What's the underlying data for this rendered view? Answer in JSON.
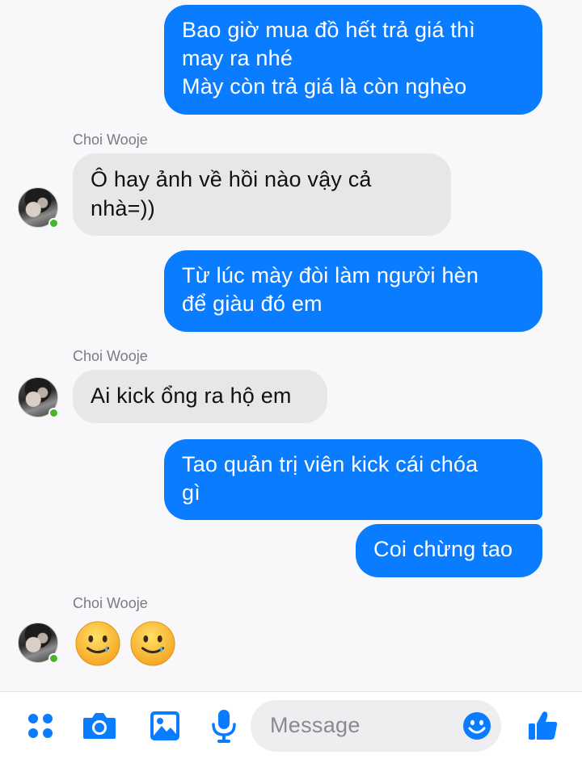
{
  "conversation": {
    "messages": [
      {
        "direction": "outgoing",
        "text": "Bao giờ mua đồ hết trả giá thì\nmay ra nhé\nMày còn trả giá là còn nghèo"
      },
      {
        "direction": "incoming",
        "sender": "Choi Wooje",
        "text": "Ô hay ảnh về hồi nào vậy cả\nnhà=))"
      },
      {
        "direction": "outgoing",
        "text": "Từ lúc mày đòi làm người hèn\nđể giàu đó em"
      },
      {
        "direction": "incoming",
        "sender": "Choi Wooje",
        "text": "Ai kick ổng ra hộ em"
      },
      {
        "direction": "outgoing",
        "text": "Tao quản trị viên kick cái chóa\ngì"
      },
      {
        "direction": "outgoing",
        "text": "Coi chừng tao"
      },
      {
        "direction": "incoming",
        "sender": "Choi Wooje",
        "emoji": [
          "smiling-face-with-tear",
          "smiling-face-with-tear"
        ]
      }
    ]
  },
  "composer": {
    "placeholder": "Message",
    "icons": [
      "grid-menu-icon",
      "camera-icon",
      "gallery-icon",
      "microphone-icon",
      "emoji-icon",
      "thumbs-up-icon"
    ]
  },
  "colors": {
    "outgoing_bubble": "#0a7cff",
    "incoming_bubble": "#e7e7ea",
    "accent": "#0a7cff",
    "online_dot": "#42b72a"
  }
}
